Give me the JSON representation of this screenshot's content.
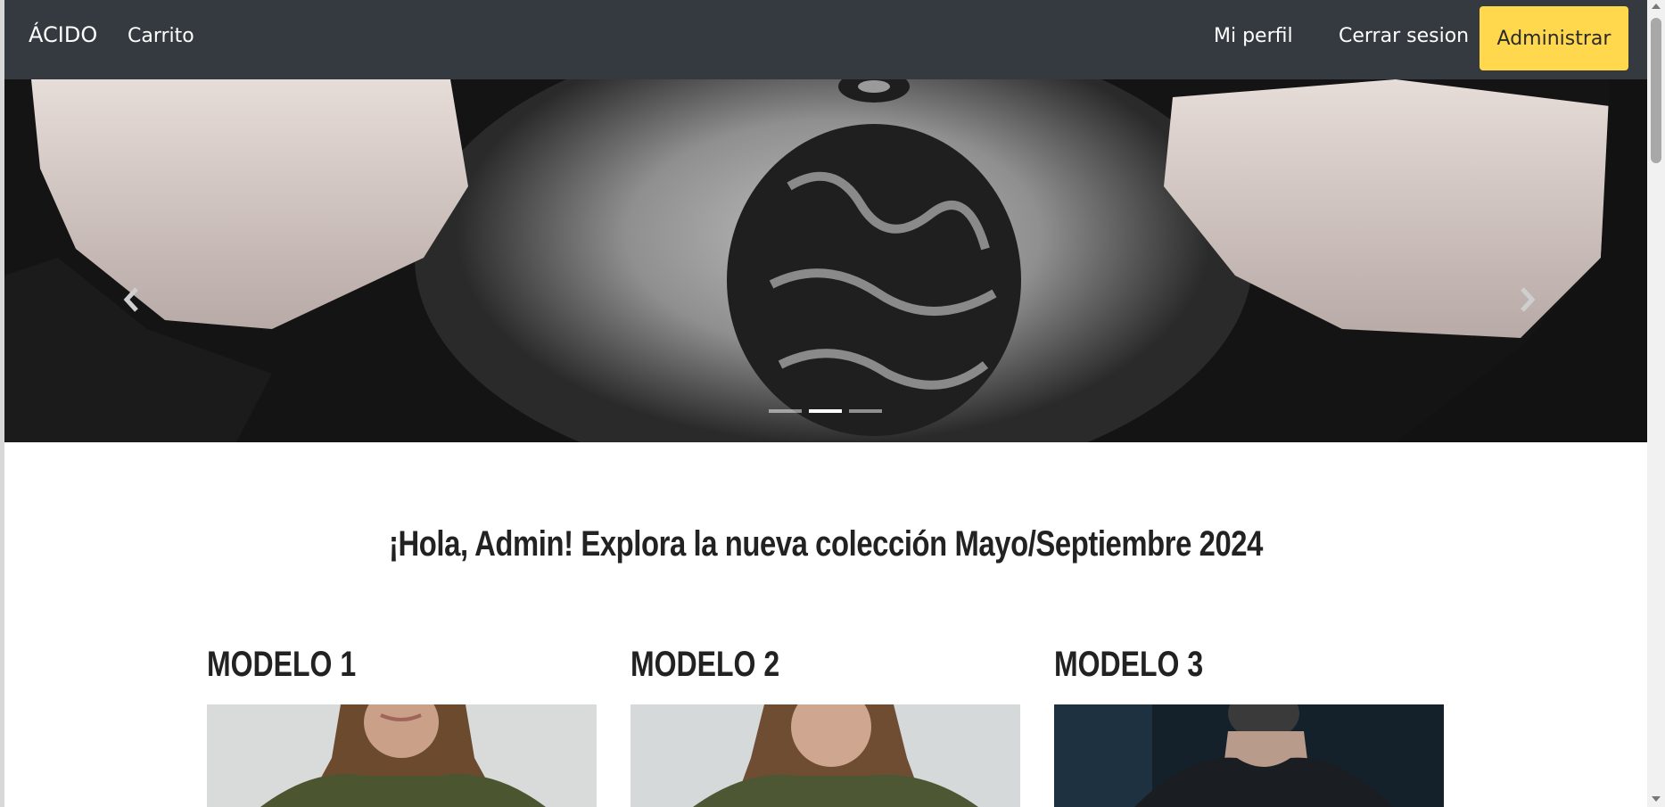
{
  "navbar": {
    "brand": "ÁCIDO",
    "cart": "Carrito",
    "profile": "Mi perfil",
    "logout": "Cerrar sesion",
    "admin": "Administrar"
  },
  "carousel": {
    "slide_count": 3,
    "active_index": 1,
    "prev_icon": "chevron-left-icon",
    "next_icon": "chevron-right-icon"
  },
  "main": {
    "welcome": "¡Hola, Admin! Explora la nueva colección Mayo/Septiembre 2024"
  },
  "models": [
    {
      "title": "MODELO 1"
    },
    {
      "title": "MODELO 2"
    },
    {
      "title": "MODELO 3"
    }
  ],
  "colors": {
    "navbar": "#343a40",
    "accent": "#ffd84d"
  }
}
